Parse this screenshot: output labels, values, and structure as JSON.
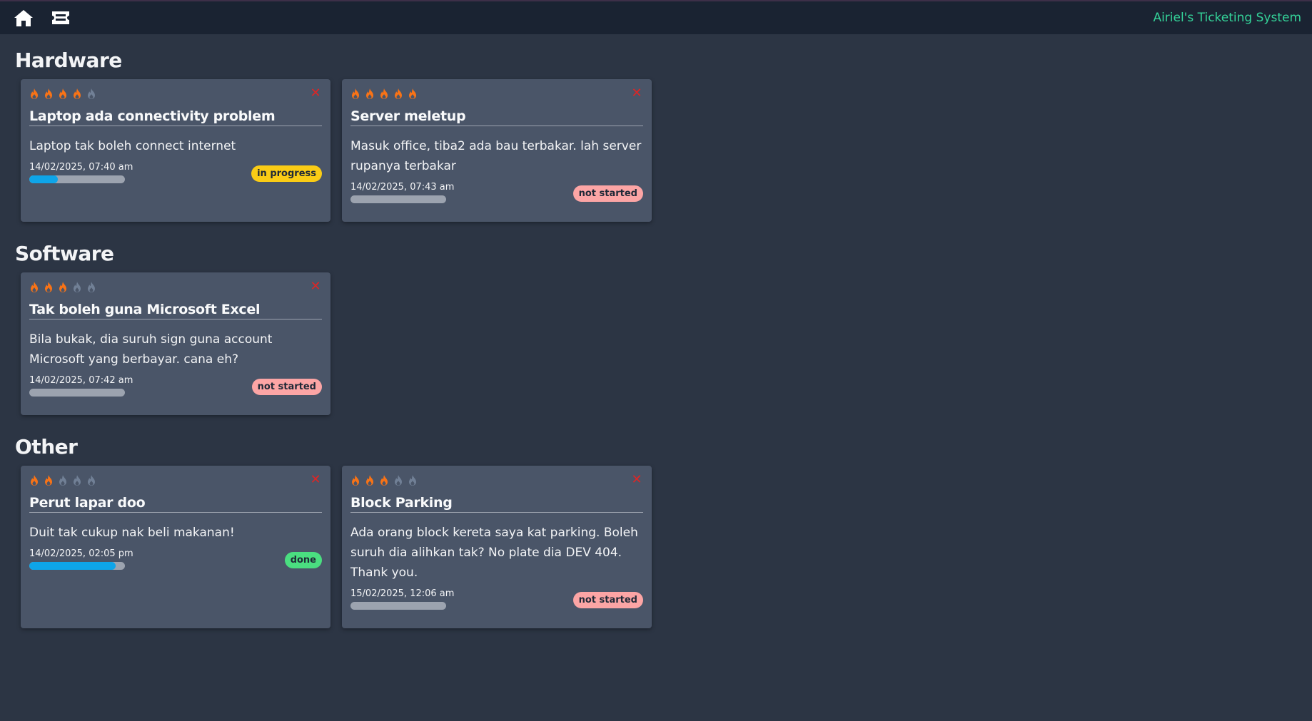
{
  "app": {
    "title": "Airiel's Ticketing System"
  },
  "nav": {
    "home_icon": "home-icon",
    "ticket_icon": "ticket-icon"
  },
  "colors": {
    "fire_active": "#f97316",
    "fire_inactive": "#718096",
    "accent": "#34d399",
    "progress": "#0ea5e9"
  },
  "sections": [
    {
      "title": "Hardware",
      "tickets": [
        {
          "priority": 4,
          "title": "Laptop ada connectivity problem",
          "description": "Laptop tak boleh connect internet",
          "time": "14/02/2025, 07:40 am",
          "progress": 0.3,
          "status": "in progress",
          "status_type": "progress"
        },
        {
          "priority": 5,
          "title": "Server meletup",
          "description": "Masuk office, tiba2 ada bau terbakar. lah server rupanya terbakar",
          "time": "14/02/2025, 07:43 am",
          "progress": 0,
          "status": "not started",
          "status_type": "notstarted"
        }
      ]
    },
    {
      "title": "Software",
      "tickets": [
        {
          "priority": 3,
          "title": "Tak boleh guna Microsoft Excel",
          "description": "Bila bukak, dia suruh sign guna account Microsoft yang berbayar. cana eh?",
          "time": "14/02/2025, 07:42 am",
          "progress": 0,
          "status": "not started",
          "status_type": "notstarted"
        }
      ]
    },
    {
      "title": "Other",
      "tickets": [
        {
          "priority": 2,
          "title": "Perut lapar doo",
          "description": "Duit tak cukup nak beli makanan!",
          "time": "14/02/2025, 02:05 pm",
          "progress": 0.9,
          "status": "done",
          "status_type": "done"
        },
        {
          "priority": 3,
          "title": "Block Parking",
          "description": "Ada orang block kereta saya kat parking. Boleh suruh dia alihkan tak? No plate dia DEV 404. Thank you.",
          "time": "15/02/2025, 12:06 am",
          "progress": 0,
          "status": "not started",
          "status_type": "notstarted"
        }
      ]
    }
  ]
}
